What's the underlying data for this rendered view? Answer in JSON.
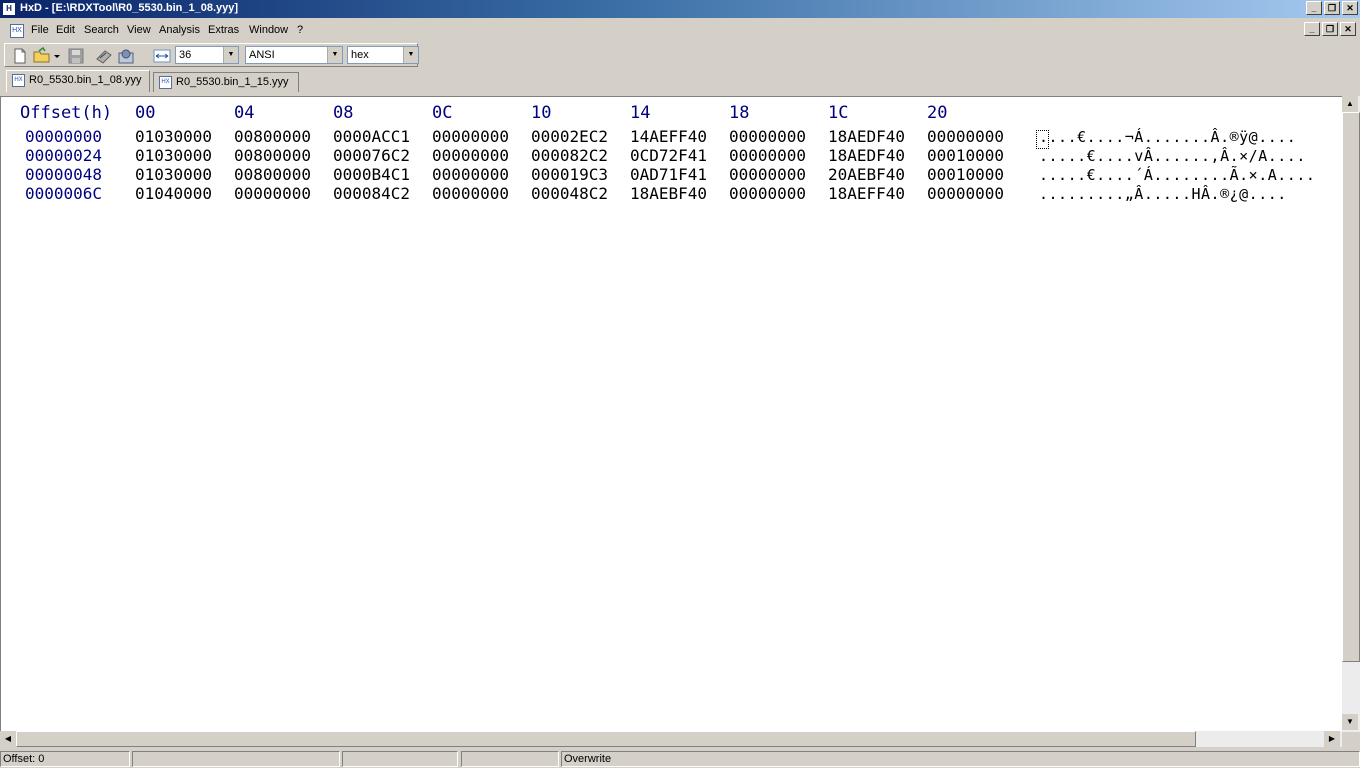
{
  "window": {
    "title": "HxD - [E:\\RDXTool\\R0_5530.bin_1_08.yyy]",
    "minimize": "_",
    "restore": "❐",
    "close": "✕"
  },
  "menu": [
    "File",
    "Edit",
    "Search",
    "View",
    "Analysis",
    "Extras",
    "Window",
    "?"
  ],
  "toolbar": {
    "bytes_per_row": "36",
    "charset": "ANSI",
    "offset_base": "hex"
  },
  "tabs": [
    {
      "label": "R0_5530.bin_1_08.yyy",
      "active": true
    },
    {
      "label": "R0_5530.bin_1_15.yyy",
      "active": false
    }
  ],
  "editor": {
    "header": [
      "Offset(h)",
      "00",
      "04",
      "08",
      "0C",
      "10",
      "14",
      "18",
      "1C",
      "20"
    ],
    "rows": [
      {
        "offset": "00000000",
        "cells": [
          "01030000",
          "00800000",
          "0000ACC1",
          "00000000",
          "00002EC2",
          "14AEFF40",
          "00000000",
          "18AEDF40",
          "00000000"
        ],
        "ascii": "....€....¬Á.......Â.®ÿ@...."
      },
      {
        "offset": "00000024",
        "cells": [
          "01030000",
          "00800000",
          "000076C2",
          "00000000",
          "000082C2",
          "0CD72F41",
          "00000000",
          "18AEDF40",
          "00010000"
        ],
        "ascii": ".....€....vÂ......‚Â.×/A...."
      },
      {
        "offset": "00000048",
        "cells": [
          "01030000",
          "00800000",
          "0000B4C1",
          "00000000",
          "000019C3",
          "0AD71F41",
          "00000000",
          "20AEBF40",
          "00010000"
        ],
        "ascii": ".....€....´Á........Ã.×.A...."
      },
      {
        "offset": "0000006C",
        "cells": [
          "01040000",
          "00000000",
          "000084C2",
          "00000000",
          "000048C2",
          "18AEBF40",
          "00000000",
          "18AEFF40",
          "00000000"
        ],
        "ascii": ".........„Â.....HÂ.®¿@...."
      }
    ]
  },
  "status": {
    "offset": "Offset: 0",
    "mode": "Overwrite"
  }
}
